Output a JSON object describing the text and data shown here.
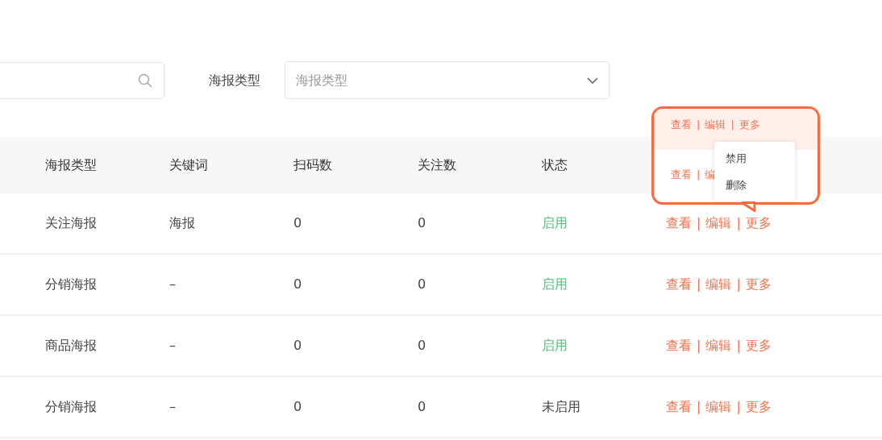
{
  "filters": {
    "type_label": "海报类型",
    "type_select": {
      "placeholder": "海报类型"
    }
  },
  "action_separator": "|",
  "table": {
    "columns": [
      "海报类型",
      "关键词",
      "扫码数",
      "关注数",
      "状态"
    ],
    "rows": [
      {
        "type": "关注海报",
        "keyword": "海报",
        "scans": "0",
        "follows": "0",
        "status": "启用",
        "enabled": true,
        "actions": [
          "查看",
          "编辑",
          "更多"
        ]
      },
      {
        "type": "分销海报",
        "keyword": "–",
        "scans": "0",
        "follows": "0",
        "status": "启用",
        "enabled": true,
        "actions": [
          "查看",
          "编辑",
          "更多"
        ]
      },
      {
        "type": "商品海报",
        "keyword": "–",
        "scans": "0",
        "follows": "0",
        "status": "启用",
        "enabled": true,
        "actions": [
          "查看",
          "编辑",
          "更多"
        ]
      },
      {
        "type": "分销海报",
        "keyword": "–",
        "scans": "0",
        "follows": "0",
        "status": "未启用",
        "enabled": false,
        "actions": [
          "查看",
          "编辑",
          "更多"
        ]
      }
    ]
  },
  "callout": {
    "top_actions": [
      "查看",
      "编辑",
      "更多"
    ],
    "lower_actions": [
      "查看",
      "编"
    ],
    "menu": [
      "禁用",
      "删除"
    ]
  }
}
